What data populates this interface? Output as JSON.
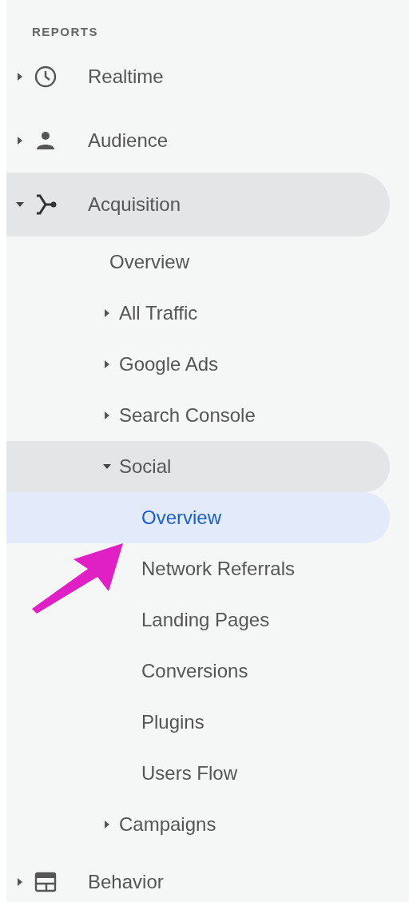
{
  "section_title": "REPORTS",
  "nav": [
    {
      "label": "Realtime",
      "expanded": false,
      "selected": false
    },
    {
      "label": "Audience",
      "expanded": false,
      "selected": false
    },
    {
      "label": "Acquisition",
      "expanded": true,
      "selected": false,
      "children": [
        {
          "label": "Overview",
          "selected": false
        },
        {
          "label": "All Traffic",
          "expanded": false,
          "selected": false
        },
        {
          "label": "Google Ads",
          "expanded": false,
          "selected": false
        },
        {
          "label": "Search Console",
          "expanded": false,
          "selected": false
        },
        {
          "label": "Social",
          "expanded": true,
          "selected": false,
          "children": [
            {
              "label": "Overview",
              "selected": true
            },
            {
              "label": "Network Referrals",
              "selected": false
            },
            {
              "label": "Landing Pages",
              "selected": false
            },
            {
              "label": "Conversions",
              "selected": false
            },
            {
              "label": "Plugins",
              "selected": false
            },
            {
              "label": "Users Flow",
              "selected": false
            }
          ]
        },
        {
          "label": "Campaigns",
          "expanded": false,
          "selected": false
        }
      ]
    },
    {
      "label": "Behavior",
      "expanded": false,
      "selected": false
    }
  ]
}
